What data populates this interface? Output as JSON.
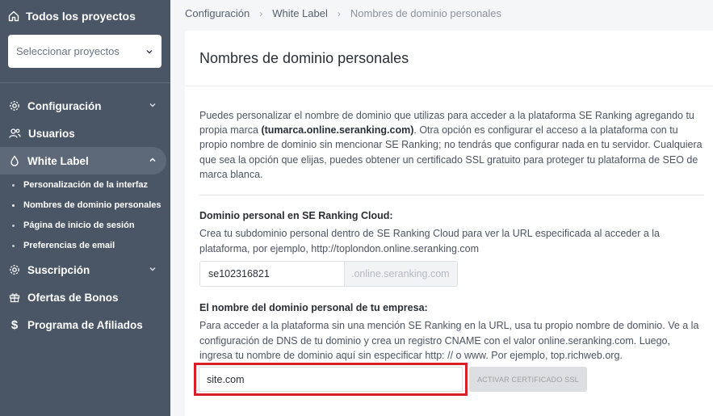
{
  "sidebar": {
    "all_projects": "Todos los proyectos",
    "select_projects_placeholder": "Seleccionar proyectos",
    "items": [
      {
        "label": "Configuración",
        "icon": "gear-icon"
      },
      {
        "label": "Usuarios",
        "icon": "users-icon"
      },
      {
        "label": "White Label",
        "icon": "drop-icon"
      },
      {
        "label": "Suscripción",
        "icon": "gear-icon"
      },
      {
        "label": "Ofertas de Bonos",
        "icon": "gift-icon"
      },
      {
        "label": "Programa de Afiliados",
        "icon": "dollar-icon"
      }
    ],
    "subitems": [
      "Personalización de la interfaz",
      "Nombres de dominio personales",
      "Página de inicio de sesión",
      "Preferencias de email"
    ]
  },
  "breadcrumb": [
    "Configuración",
    "White Label",
    "Nombres de dominio personales"
  ],
  "card": {
    "title": "Nombres de dominio personales",
    "intro_part1": "Puedes personalizar el nombre de dominio que utilizas para acceder a la plataforma SE Ranking agregando tu propia marca ",
    "intro_bold": "(tumarca.online.seranking.com)",
    "intro_part2": ". Otra opción es configurar el acceso a la plataforma con tu propio nombre de dominio sin mencionar SE Ranking; no tendrás que configurar nada en tu servidor. Cualquiera que sea la opción que elijas, puedes obtener un certificado SSL gratuito para proteger tu plataforma de SEO de marca blanca."
  },
  "cloud": {
    "title": "Dominio personal en SE Ranking Cloud:",
    "desc": "Crea tu subdominio personal dentro de SE Ranking Cloud para ver la URL especificada al acceder a la plataforma, por ejemplo, http://toplondon.online.seranking.com",
    "value": "se102316821",
    "suffix": ".online.seranking.com"
  },
  "company": {
    "title": "El nombre del dominio personal de tu empresa:",
    "desc": "Para acceder a la plataforma sin una mención SE Ranking en la URL, usa tu propio nombre de dominio. Ve a la configuración de DNS de tu dominio y crea un registro CNAME con el valor online.seranking.com. Luego, ingresa tu nombre de dominio aquí sin especificar http: // o www. Por ejemplo, top.richweb.org.",
    "value": "site.com",
    "ssl_button": "ACTIVAR CERTIFICADO SSL"
  },
  "colors": {
    "sidebar_bg": "#4a5566",
    "highlight": "#d91f26"
  }
}
